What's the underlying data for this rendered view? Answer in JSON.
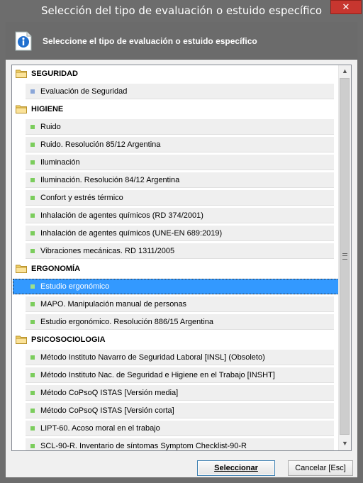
{
  "window": {
    "title": "Selección del tipo de evaluación o estuido específico",
    "close_glyph": "✕"
  },
  "header": {
    "icon": "info-icon",
    "text": "Seleccione el tipo de evaluación o estuido específico"
  },
  "list": {
    "rows": [
      {
        "type": "group",
        "label": "SEGURIDAD"
      },
      {
        "type": "item",
        "label": "Evaluación de Seguridad",
        "bullet": "blue"
      },
      {
        "type": "group",
        "label": "HIGIENE"
      },
      {
        "type": "item",
        "label": "Ruido",
        "bullet": "green"
      },
      {
        "type": "item",
        "label": "Ruido. Resolución 85/12 Argentina",
        "bullet": "green"
      },
      {
        "type": "item",
        "label": "Iluminación",
        "bullet": "green"
      },
      {
        "type": "item",
        "label": "Iluminación. Resolución 84/12 Argentina",
        "bullet": "green"
      },
      {
        "type": "item",
        "label": "Confort y estrés térmico",
        "bullet": "green"
      },
      {
        "type": "item",
        "label": "Inhalación de agentes químicos (RD 374/2001)",
        "bullet": "green"
      },
      {
        "type": "item",
        "label": "Inhalación de agentes químicos (UNE-EN 689:2019)",
        "bullet": "green"
      },
      {
        "type": "item",
        "label": "Vibraciones mecánicas. RD 1311/2005",
        "bullet": "green"
      },
      {
        "type": "group",
        "label": "ERGONOMÍA"
      },
      {
        "type": "item",
        "label": "Estudio ergonómico",
        "bullet": "green",
        "selected": true
      },
      {
        "type": "item",
        "label": "MAPO. Manipulación manual de personas",
        "bullet": "green"
      },
      {
        "type": "item",
        "label": "Estudio ergonómico. Resolución 886/15 Argentina",
        "bullet": "green"
      },
      {
        "type": "group",
        "label": "PSICOSOCIOLOGIA"
      },
      {
        "type": "item",
        "label": "Método Instituto Navarro de Seguridad Laboral  [INSL]  (Obsoleto)",
        "bullet": "green"
      },
      {
        "type": "item",
        "label": "Método Instituto Nac. de Seguridad e Higiene en el Trabajo  [INSHT]",
        "bullet": "green"
      },
      {
        "type": "item",
        "label": "Método CoPsoQ ISTAS  [Versión media]",
        "bullet": "green"
      },
      {
        "type": "item",
        "label": "Método CoPsoQ ISTAS  [Versión corta]",
        "bullet": "green"
      },
      {
        "type": "item",
        "label": "LIPT-60. Acoso moral en el trabajo",
        "bullet": "green"
      },
      {
        "type": "item",
        "label": "SCL-90-R. Inventario de síntomas Symptom Checklist-90-R",
        "bullet": "green"
      }
    ]
  },
  "buttons": {
    "select_label": "Seleccionar",
    "cancel_label": "Cancelar  [Esc]"
  },
  "colors": {
    "selection": "#3399ff",
    "bullet_green": "#7bcd5c",
    "bullet_blue": "#8aa6d8",
    "close": "#c7362f"
  }
}
